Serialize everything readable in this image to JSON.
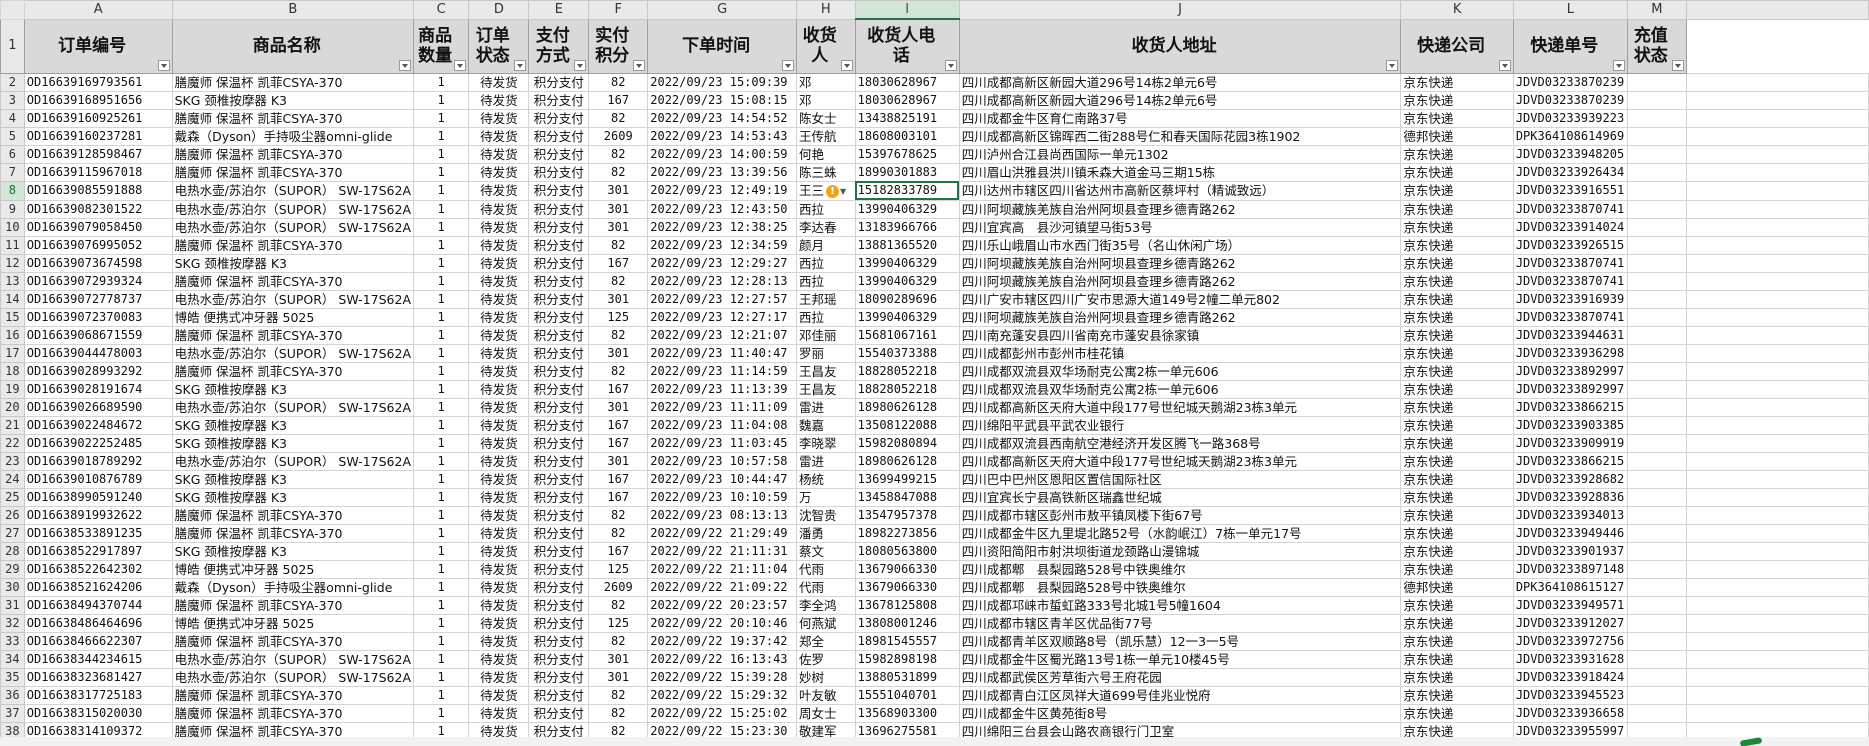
{
  "colors": {
    "accent": "#217346",
    "header_bg": "#d9d9d9",
    "warning": "#f0a21c"
  },
  "columns": [
    "A",
    "B",
    "C",
    "D",
    "E",
    "F",
    "G",
    "H",
    "I",
    "J",
    "K",
    "L",
    "M"
  ],
  "active_column": "I",
  "active_row": "8",
  "headers": [
    "订单编号",
    "商品名称",
    "商品数量",
    "订单状态",
    "支付方式",
    "实付积分",
    "下单时间",
    "收货人",
    "收货人电话",
    "收货人地址",
    "快递公司",
    "快递单号",
    "充值状态"
  ],
  "rows": [
    {
      "n": "2",
      "id": "OD16639169793561",
      "name": "膳魔师 保温杯 凯菲CSYA-370",
      "qty": "1",
      "status": "待发货",
      "pay": "积分支付",
      "points": "82",
      "time": "2022/09/23 15:09:39",
      "recv": "邓",
      "phone": "18030628967",
      "addr": "四川成都高新区新园大道296号14栋2单元6号",
      "express": "京东快递",
      "track": "JDVD03233870239",
      "charge": ""
    },
    {
      "n": "3",
      "id": "OD16639168951656",
      "name": "SKG 颈椎按摩器 K3",
      "qty": "1",
      "status": "待发货",
      "pay": "积分支付",
      "points": "167",
      "time": "2022/09/23 15:08:15",
      "recv": "邓",
      "phone": "18030628967",
      "addr": "四川成都高新区新园大道296号14栋2单元6号",
      "express": "京东快递",
      "track": "JDVD03233870239",
      "charge": ""
    },
    {
      "n": "4",
      "id": "OD16639160925261",
      "name": "膳魔师 保温杯 凯菲CSYA-370",
      "qty": "1",
      "status": "待发货",
      "pay": "积分支付",
      "points": "82",
      "time": "2022/09/23 14:54:52",
      "recv": "陈女士",
      "phone": "13438825191",
      "addr": "四川成都金牛区育仁南路37号",
      "express": "京东快递",
      "track": "JDVD03233939223",
      "charge": ""
    },
    {
      "n": "5",
      "id": "OD16639160237281",
      "name": "戴森（Dyson）手持吸尘器omni-glide",
      "qty": "1",
      "status": "待发货",
      "pay": "积分支付",
      "points": "2609",
      "time": "2022/09/23 14:53:43",
      "recv": "王传航",
      "phone": "18608003101",
      "addr": "四川成都高新区锦晖西二街288号仁和春天国际花园3栋1902",
      "express": "德邦快递",
      "track": "DPK364108614969",
      "charge": ""
    },
    {
      "n": "6",
      "id": "OD16639128598467",
      "name": "膳魔师 保温杯 凯菲CSYA-370",
      "qty": "1",
      "status": "待发货",
      "pay": "积分支付",
      "points": "82",
      "time": "2022/09/23 14:00:59",
      "recv": "何艳",
      "phone": "15397678625",
      "addr": "四川泸州合江县尚西国际一单元1302",
      "express": "京东快递",
      "track": "JDVD03233948205",
      "charge": ""
    },
    {
      "n": "7",
      "id": "OD16639115967018",
      "name": "膳魔师 保温杯 凯菲CSYA-370",
      "qty": "1",
      "status": "待发货",
      "pay": "积分支付",
      "points": "82",
      "time": "2022/09/23 13:39:56",
      "recv": "陈三蛛",
      "phone": "18990301883",
      "addr": "四川眉山洪雅县洪川镇禾森大道金马三期15栋",
      "express": "京东快递",
      "track": "JDVD03233926434",
      "charge": ""
    },
    {
      "n": "8",
      "id": "OD16639085591888",
      "name": "电热水壶/苏泊尔（SUPOR） SW-17S62A",
      "qty": "1",
      "status": "待发货",
      "pay": "积分支付",
      "points": "301",
      "time": "2022/09/23 12:49:19",
      "recv": "王三",
      "phone": "15182833789",
      "addr": "四川达州市辖区四川省达州市高新区蔡坪村（精诚致远）",
      "express": "京东快递",
      "track": "JDVD03233916551",
      "charge": ""
    },
    {
      "n": "9",
      "id": "OD16639082301522",
      "name": "电热水壶/苏泊尔（SUPOR） SW-17S62A",
      "qty": "1",
      "status": "待发货",
      "pay": "积分支付",
      "points": "301",
      "time": "2022/09/23 12:43:50",
      "recv": "西拉",
      "phone": "13990406329",
      "addr": "四川阿坝藏族羌族自治州阿坝县查理乡德青路262",
      "express": "京东快递",
      "track": "JDVD03233870741",
      "charge": ""
    },
    {
      "n": "10",
      "id": "OD16639079058450",
      "name": "电热水壶/苏泊尔（SUPOR） SW-17S62A",
      "qty": "1",
      "status": "待发货",
      "pay": "积分支付",
      "points": "301",
      "time": "2022/09/23 12:38:25",
      "recv": "李达春",
      "phone": "13183966766",
      "addr": "四川宜宾高　县沙河镇望马街53号",
      "express": "京东快递",
      "track": "JDVD03233914024",
      "charge": ""
    },
    {
      "n": "11",
      "id": "OD16639076995052",
      "name": "膳魔师 保温杯 凯菲CSYA-370",
      "qty": "1",
      "status": "待发货",
      "pay": "积分支付",
      "points": "82",
      "time": "2022/09/23 12:34:59",
      "recv": "颜月",
      "phone": "13881365520",
      "addr": "四川乐山峨眉山市水西门街35号（名山休闲广场）",
      "express": "京东快递",
      "track": "JDVD03233926515",
      "charge": ""
    },
    {
      "n": "12",
      "id": "OD16639073674598",
      "name": "SKG 颈椎按摩器 K3",
      "qty": "1",
      "status": "待发货",
      "pay": "积分支付",
      "points": "167",
      "time": "2022/09/23 12:29:27",
      "recv": "西拉",
      "phone": "13990406329",
      "addr": "四川阿坝藏族羌族自治州阿坝县查理乡德青路262",
      "express": "京东快递",
      "track": "JDVD03233870741",
      "charge": ""
    },
    {
      "n": "13",
      "id": "OD16639072939324",
      "name": "膳魔师 保温杯 凯菲CSYA-370",
      "qty": "1",
      "status": "待发货",
      "pay": "积分支付",
      "points": "82",
      "time": "2022/09/23 12:28:13",
      "recv": "西拉",
      "phone": "13990406329",
      "addr": "四川阿坝藏族羌族自治州阿坝县查理乡德青路262",
      "express": "京东快递",
      "track": "JDVD03233870741",
      "charge": ""
    },
    {
      "n": "14",
      "id": "OD16639072778737",
      "name": "电热水壶/苏泊尔（SUPOR） SW-17S62A",
      "qty": "1",
      "status": "待发货",
      "pay": "积分支付",
      "points": "301",
      "time": "2022/09/23 12:27:57",
      "recv": "王邦瑶",
      "phone": "18090289696",
      "addr": "四川广安市辖区四川广安市思源大道149号2幢二单元802",
      "express": "京东快递",
      "track": "JDVD03233916939",
      "charge": ""
    },
    {
      "n": "15",
      "id": "OD16639072370083",
      "name": "博皓 便携式冲牙器 5025",
      "qty": "1",
      "status": "待发货",
      "pay": "积分支付",
      "points": "125",
      "time": "2022/09/23 12:27:17",
      "recv": "西拉",
      "phone": "13990406329",
      "addr": "四川阿坝藏族羌族自治州阿坝县查理乡德青路262",
      "express": "京东快递",
      "track": "JDVD03233870741",
      "charge": ""
    },
    {
      "n": "16",
      "id": "OD16639068671559",
      "name": "膳魔师 保温杯 凯菲CSYA-370",
      "qty": "1",
      "status": "待发货",
      "pay": "积分支付",
      "points": "82",
      "time": "2022/09/23 12:21:07",
      "recv": "邓佳丽",
      "phone": "15681067161",
      "addr": "四川南充蓬安县四川省南充市蓬安县徐家镇",
      "express": "京东快递",
      "track": "JDVD03233944631",
      "charge": ""
    },
    {
      "n": "17",
      "id": "OD16639044478003",
      "name": "电热水壶/苏泊尔（SUPOR） SW-17S62A",
      "qty": "1",
      "status": "待发货",
      "pay": "积分支付",
      "points": "301",
      "time": "2022/09/23 11:40:47",
      "recv": "罗丽",
      "phone": "15540373388",
      "addr": "四川成都彭州市彭州市桂花镇",
      "express": "京东快递",
      "track": "JDVD03233936298",
      "charge": ""
    },
    {
      "n": "18",
      "id": "OD16639028993292",
      "name": "膳魔师 保温杯 凯菲CSYA-370",
      "qty": "1",
      "status": "待发货",
      "pay": "积分支付",
      "points": "82",
      "time": "2022/09/23 11:14:59",
      "recv": "王昌友",
      "phone": "18828052218",
      "addr": "四川成都双流县双华场耐克公寓2栋一单元606",
      "express": "京东快递",
      "track": "JDVD03233892997",
      "charge": ""
    },
    {
      "n": "19",
      "id": "OD16639028191674",
      "name": "SKG 颈椎按摩器 K3",
      "qty": "1",
      "status": "待发货",
      "pay": "积分支付",
      "points": "167",
      "time": "2022/09/23 11:13:39",
      "recv": "王昌友",
      "phone": "18828052218",
      "addr": "四川成都双流县双华场耐克公寓2栋一单元606",
      "express": "京东快递",
      "track": "JDVD03233892997",
      "charge": ""
    },
    {
      "n": "20",
      "id": "OD16639026689590",
      "name": "电热水壶/苏泊尔（SUPOR） SW-17S62A",
      "qty": "1",
      "status": "待发货",
      "pay": "积分支付",
      "points": "301",
      "time": "2022/09/23 11:11:09",
      "recv": "雷进",
      "phone": "18980626128",
      "addr": "四川成都高新区天府大道中段177号世纪城天鹅湖23栋3单元",
      "express": "京东快递",
      "track": "JDVD03233866215",
      "charge": ""
    },
    {
      "n": "21",
      "id": "OD16639022484672",
      "name": "SKG 颈椎按摩器 K3",
      "qty": "1",
      "status": "待发货",
      "pay": "积分支付",
      "points": "167",
      "time": "2022/09/23 11:04:08",
      "recv": "魏嘉",
      "phone": "13508122088",
      "addr": "四川绵阳平武县平武农业银行",
      "express": "京东快递",
      "track": "JDVD03233903385",
      "charge": ""
    },
    {
      "n": "22",
      "id": "OD16639022252485",
      "name": "SKG 颈椎按摩器 K3",
      "qty": "1",
      "status": "待发货",
      "pay": "积分支付",
      "points": "167",
      "time": "2022/09/23 11:03:45",
      "recv": "李晓翠",
      "phone": "15982080894",
      "addr": "四川成都双流县西南航空港经济开发区腾飞一路368号",
      "express": "京东快递",
      "track": "JDVD03233909919",
      "charge": ""
    },
    {
      "n": "23",
      "id": "OD16639018789292",
      "name": "电热水壶/苏泊尔（SUPOR） SW-17S62A",
      "qty": "1",
      "status": "待发货",
      "pay": "积分支付",
      "points": "301",
      "time": "2022/09/23 10:57:58",
      "recv": "雷进",
      "phone": "18980626128",
      "addr": "四川成都高新区天府大道中段177号世纪城天鹅湖23栋3单元",
      "express": "京东快递",
      "track": "JDVD03233866215",
      "charge": ""
    },
    {
      "n": "24",
      "id": "OD16639010876789",
      "name": "SKG 颈椎按摩器 K3",
      "qty": "1",
      "status": "待发货",
      "pay": "积分支付",
      "points": "167",
      "time": "2022/09/23 10:44:47",
      "recv": "杨统",
      "phone": "13699499215",
      "addr": "四川巴中巴州区恩阳区置信国际社区",
      "express": "京东快递",
      "track": "JDVD03233928682",
      "charge": ""
    },
    {
      "n": "25",
      "id": "OD16638990591240",
      "name": "SKG 颈椎按摩器 K3",
      "qty": "1",
      "status": "待发货",
      "pay": "积分支付",
      "points": "167",
      "time": "2022/09/23 10:10:59",
      "recv": "万",
      "phone": "13458847088",
      "addr": "四川宜宾长宁县高铁新区瑞鑫世纪城",
      "express": "京东快递",
      "track": "JDVD03233928836",
      "charge": ""
    },
    {
      "n": "26",
      "id": "OD16638919932622",
      "name": "膳魔师 保温杯 凯菲CSYA-370",
      "qty": "1",
      "status": "待发货",
      "pay": "积分支付",
      "points": "82",
      "time": "2022/09/23 08:13:13",
      "recv": "沈智贵",
      "phone": "13547957378",
      "addr": "四川成都市辖区彭州市敖平镇凤楼下街67号",
      "express": "京东快递",
      "track": "JDVD03233934013",
      "charge": ""
    },
    {
      "n": "27",
      "id": "OD16638533891235",
      "name": "膳魔师 保温杯 凯菲CSYA-370",
      "qty": "1",
      "status": "待发货",
      "pay": "积分支付",
      "points": "82",
      "time": "2022/09/22 21:29:49",
      "recv": "潘勇",
      "phone": "18982273856",
      "addr": "四川成都金牛区九里堤北路52号（水韵岷江）7栋一单元17号",
      "express": "京东快递",
      "track": "JDVD03233949446",
      "charge": ""
    },
    {
      "n": "28",
      "id": "OD16638522917897",
      "name": "SKG 颈椎按摩器 K3",
      "qty": "1",
      "status": "待发货",
      "pay": "积分支付",
      "points": "167",
      "time": "2022/09/22 21:11:31",
      "recv": "蔡文",
      "phone": "18080563800",
      "addr": "四川资阳简阳市射洪坝街道龙颈路山漫锦城",
      "express": "京东快递",
      "track": "JDVD03233901937",
      "charge": ""
    },
    {
      "n": "29",
      "id": "OD16638522642302",
      "name": "博皓 便携式冲牙器 5025",
      "qty": "1",
      "status": "待发货",
      "pay": "积分支付",
      "points": "125",
      "time": "2022/09/22 21:11:04",
      "recv": "代雨",
      "phone": "13679066330",
      "addr": "四川成都郫　县梨园路528号中铁奥维尔",
      "express": "京东快递",
      "track": "JDVD03233897148",
      "charge": ""
    },
    {
      "n": "30",
      "id": "OD16638521624206",
      "name": "戴森（Dyson）手持吸尘器omni-glide",
      "qty": "1",
      "status": "待发货",
      "pay": "积分支付",
      "points": "2609",
      "time": "2022/09/22 21:09:22",
      "recv": "代雨",
      "phone": "13679066330",
      "addr": "四川成都郫　县梨园路528号中铁奥维尔",
      "express": "德邦快递",
      "track": "DPK364108615127",
      "charge": ""
    },
    {
      "n": "31",
      "id": "OD16638494370744",
      "name": "膳魔师 保温杯 凯菲CSYA-370",
      "qty": "1",
      "status": "待发货",
      "pay": "积分支付",
      "points": "82",
      "time": "2022/09/22 20:23:57",
      "recv": "李全鸿",
      "phone": "13678125808",
      "addr": "四川成都邛崃市蜇虹路333号北城1号5幢1604",
      "express": "京东快递",
      "track": "JDVD03233949571",
      "charge": ""
    },
    {
      "n": "32",
      "id": "OD16638486464696",
      "name": "博皓 便携式冲牙器 5025",
      "qty": "1",
      "status": "待发货",
      "pay": "积分支付",
      "points": "125",
      "time": "2022/09/22 20:10:46",
      "recv": "何燕斌",
      "phone": "13808001246",
      "addr": "四川成都市辖区青羊区优品街77号",
      "express": "京东快递",
      "track": "JDVD03233912027",
      "charge": ""
    },
    {
      "n": "33",
      "id": "OD16638466622307",
      "name": "膳魔师 保温杯 凯菲CSYA-370",
      "qty": "1",
      "status": "待发货",
      "pay": "积分支付",
      "points": "82",
      "time": "2022/09/22 19:37:42",
      "recv": "郑全",
      "phone": "18981545557",
      "addr": "四川成都青羊区双顺路8号（凯乐慧）12一3一5号",
      "express": "京东快递",
      "track": "JDVD03233972756",
      "charge": ""
    },
    {
      "n": "34",
      "id": "OD16638344234615",
      "name": "电热水壶/苏泊尔（SUPOR） SW-17S62A",
      "qty": "1",
      "status": "待发货",
      "pay": "积分支付",
      "points": "301",
      "time": "2022/09/22 16:13:43",
      "recv": "佐罗",
      "phone": "15982898198",
      "addr": "四川成都金牛区蜀光路13号1栋一单元10楼45号",
      "express": "京东快递",
      "track": "JDVD03233931628",
      "charge": ""
    },
    {
      "n": "35",
      "id": "OD16638323681427",
      "name": "电热水壶/苏泊尔（SUPOR） SW-17S62A",
      "qty": "1",
      "status": "待发货",
      "pay": "积分支付",
      "points": "301",
      "time": "2022/09/22 15:39:28",
      "recv": "妙树",
      "phone": "13880531899",
      "addr": "四川成都武侯区芳草街六号王府花园",
      "express": "京东快递",
      "track": "JDVD03233918424",
      "charge": ""
    },
    {
      "n": "36",
      "id": "OD16638317725183",
      "name": "膳魔师 保温杯 凯菲CSYA-370",
      "qty": "1",
      "status": "待发货",
      "pay": "积分支付",
      "points": "82",
      "time": "2022/09/22 15:29:32",
      "recv": "叶友敏",
      "phone": "15551040701",
      "addr": "四川成都青白江区凤祥大道699号佳兆业悦府",
      "express": "京东快递",
      "track": "JDVD03233945523",
      "charge": ""
    },
    {
      "n": "37",
      "id": "OD16638315020030",
      "name": "膳魔师 保温杯 凯菲CSYA-370",
      "qty": "1",
      "status": "待发货",
      "pay": "积分支付",
      "points": "82",
      "time": "2022/09/22 15:25:02",
      "recv": "周女士",
      "phone": "13568903300",
      "addr": "四川成都金牛区黄苑街8号",
      "express": "京东快递",
      "track": "JDVD03233936658",
      "charge": ""
    },
    {
      "n": "38",
      "id": "OD16638314109372",
      "name": "膳魔师 保温杯 凯菲CSYA-370",
      "qty": "1",
      "status": "待发货",
      "pay": "积分支付",
      "points": "82",
      "time": "2022/09/22 15:23:30",
      "recv": "敬建军",
      "phone": "13696275581",
      "addr": "四川绵阳三台县会山路农商银行门卫室",
      "express": "京东快递",
      "track": "JDVD03233955997",
      "charge": ""
    }
  ]
}
